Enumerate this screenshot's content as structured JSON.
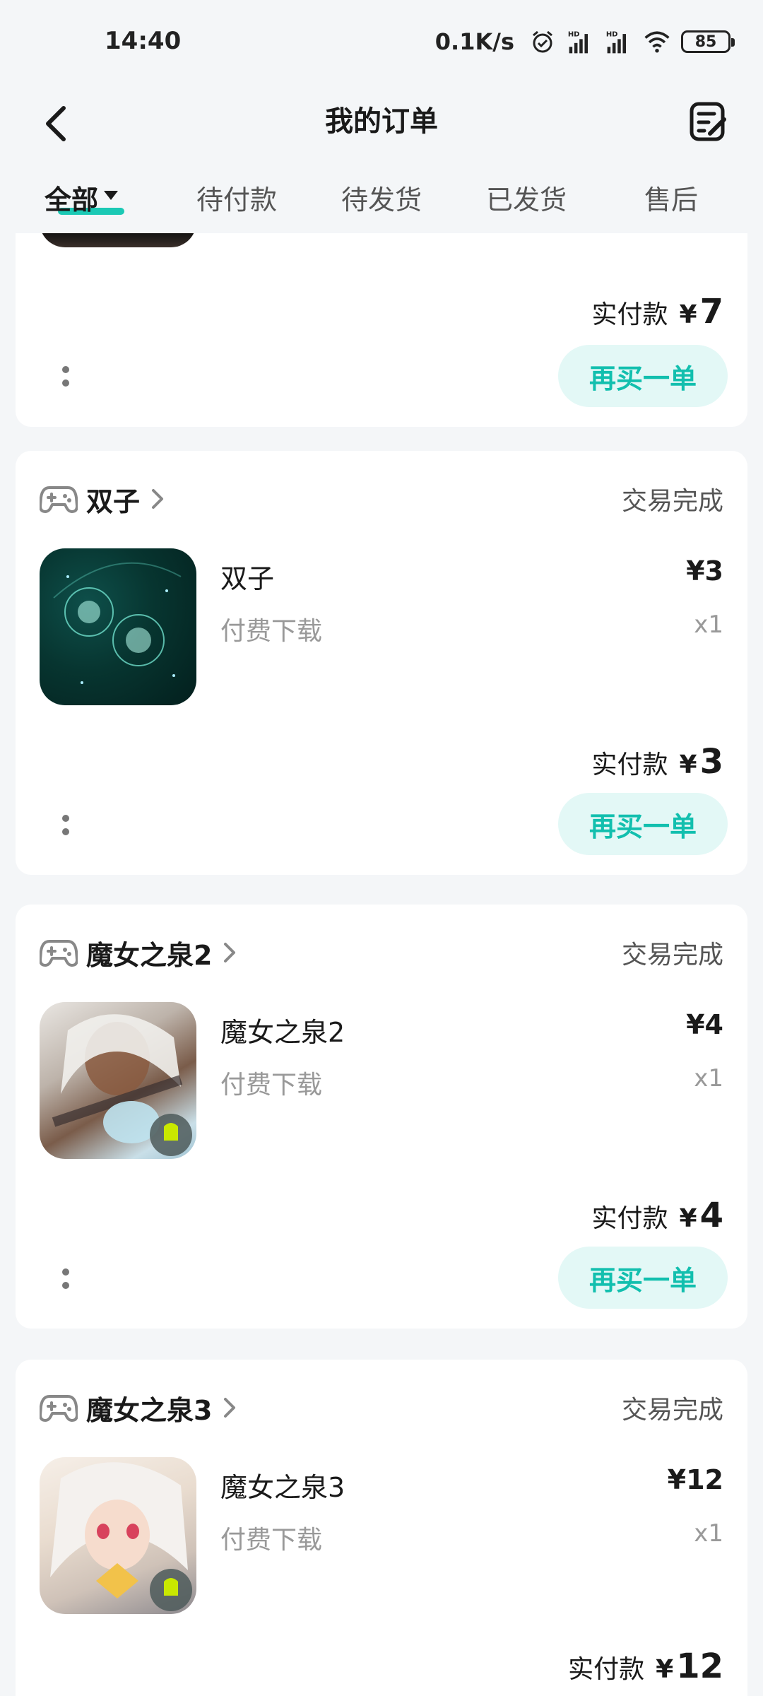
{
  "status_bar": {
    "time": "14:40",
    "net_speed": "0.1K/s",
    "battery": "85"
  },
  "nav": {
    "title": "我的订单"
  },
  "tabs": [
    {
      "label": "全部",
      "active": true
    },
    {
      "label": "待付款"
    },
    {
      "label": "待发货"
    },
    {
      "label": "已发货"
    },
    {
      "label": "售后"
    }
  ],
  "orders": [
    {
      "paid_label": "实付款",
      "currency": "¥",
      "paid_amount": "7",
      "action_label": "再买一单"
    },
    {
      "shop": "双子",
      "status": "交易完成",
      "item_name": "双子",
      "item_type": "付费下载",
      "price": "¥3",
      "qty": "x1",
      "paid_label": "实付款",
      "currency": "¥",
      "paid_amount": "3",
      "action_label": "再买一单"
    },
    {
      "shop": "魔女之泉2",
      "status": "交易完成",
      "item_name": "魔女之泉2",
      "item_type": "付费下载",
      "price": "¥4",
      "qty": "x1",
      "paid_label": "实付款",
      "currency": "¥",
      "paid_amount": "4",
      "action_label": "再买一单"
    },
    {
      "shop": "魔女之泉3",
      "status": "交易完成",
      "item_name": "魔女之泉3",
      "item_type": "付费下载",
      "price": "¥12",
      "qty": "x1",
      "paid_label": "实付款",
      "currency": "¥",
      "paid_amount": "12"
    }
  ],
  "colors": {
    "accent": "#1BC9B5",
    "button_bg": "#E3F8F6",
    "button_text": "#12BFAE",
    "page_bg": "#F4F6F8"
  },
  "icons": {
    "back": "chevron-left-icon",
    "edit": "order-edit-icon",
    "shop": "gamepad-icon",
    "more": "more-vertical-icon"
  }
}
